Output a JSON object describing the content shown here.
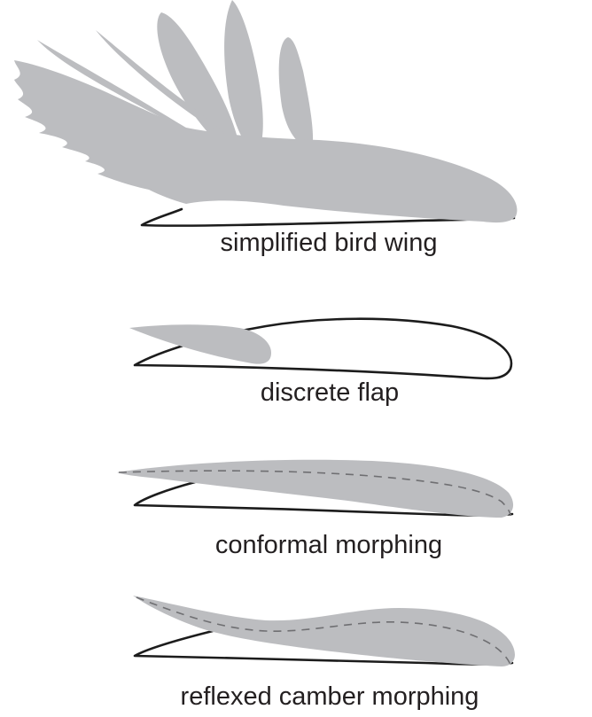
{
  "panels": [
    {
      "id": "bird",
      "label": "simplified bird wing"
    },
    {
      "id": "flap",
      "label": "discrete flap"
    },
    {
      "id": "conformal",
      "label": "conformal morphing"
    },
    {
      "id": "reflexed",
      "label": "reflexed camber morphing"
    }
  ],
  "colors": {
    "wing_gray": "#bcbdc0",
    "outline": "#1c1c1c",
    "camber_line": "#6f6f72",
    "text": "#231f20"
  }
}
